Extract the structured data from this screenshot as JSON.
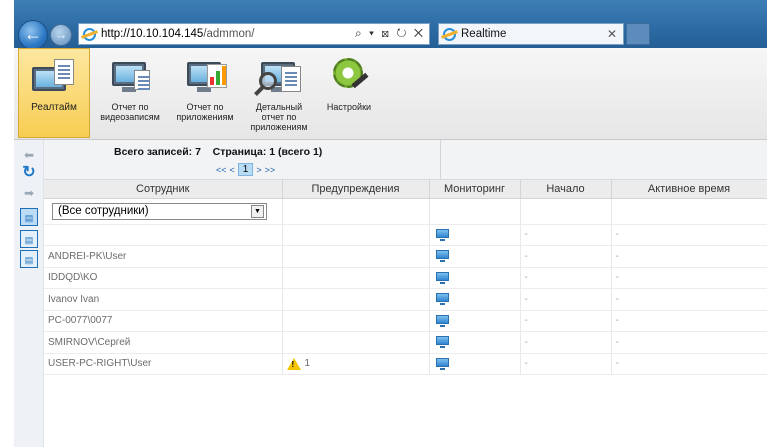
{
  "browser": {
    "url_host": "http://10.10.104.145",
    "url_path": "/admmon/",
    "address_tools": "⌕ ▾ ⊠ ↻ ✕",
    "tab_title": "Realtime",
    "tab_close": "✕"
  },
  "ribbon": {
    "items": [
      {
        "label": "Реалтайм"
      },
      {
        "label": "Отчет по видеозаписям"
      },
      {
        "label": "Отчет по приложениям"
      },
      {
        "label": "Детальный отчет по приложениям"
      },
      {
        "label": "Настройки"
      }
    ]
  },
  "pager": {
    "total_label": "Всего записей:",
    "total": "7",
    "page_label": "Страница:",
    "page_value": "1 (всего 1)",
    "first": "<<",
    "prev": "<",
    "current": "1",
    "next": ">",
    "last": ">>"
  },
  "table": {
    "headers": [
      "Сотрудник",
      "Предупреждения",
      "Мониторинг",
      "Начало",
      "Активное время"
    ],
    "filter_value": "(Все сотрудники)",
    "rows": [
      {
        "employee": "",
        "warnings": "",
        "start": "-",
        "active": "-"
      },
      {
        "employee": "ANDREI-PK\\User",
        "warnings": "",
        "start": "-",
        "active": "-"
      },
      {
        "employee": "IDDQD\\KO",
        "warnings": "",
        "start": "-",
        "active": "-"
      },
      {
        "employee": "Ivanov Ivan",
        "warnings": "",
        "start": "-",
        "active": "-"
      },
      {
        "employee": "PC-0077\\0077",
        "warnings": "",
        "start": "-",
        "active": "-"
      },
      {
        "employee": "SMIRNOV\\Сергей",
        "warnings": "",
        "start": "-",
        "active": "-"
      },
      {
        "employee": "USER-PC-RIGHT\\User",
        "warnings": "1",
        "start": "-",
        "active": "-"
      }
    ]
  },
  "icons": [
    "back-arrow-icon",
    "forward-arrow-icon",
    "refresh-icon",
    "monitor-icon",
    "warning-icon"
  ],
  "colors": {
    "accent": "#f7cd52",
    "chrome": "#2c6aa3",
    "link": "#1b5fa8"
  }
}
